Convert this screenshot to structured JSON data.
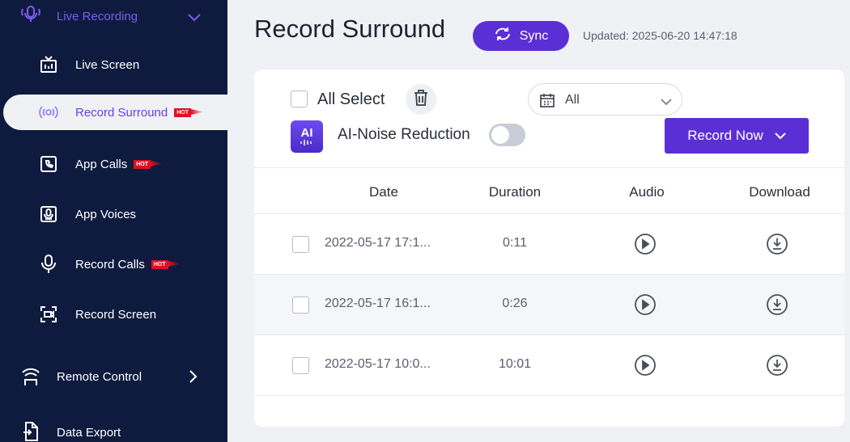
{
  "sidebar": {
    "group_live": "Live Recording",
    "items": [
      {
        "label": "Live Screen",
        "hot": false
      },
      {
        "label": "Record Surround",
        "hot": true
      },
      {
        "label": "App Calls",
        "hot": true
      },
      {
        "label": "App Voices",
        "hot": false
      },
      {
        "label": "Record Calls",
        "hot": true
      },
      {
        "label": "Record Screen",
        "hot": false
      }
    ],
    "group_remote": "Remote Control",
    "group_export": "Data Export",
    "hot_label": "HOT"
  },
  "header": {
    "title": "Record Surround",
    "sync_label": "Sync",
    "updated": "Updated: 2025-06-20 14:47:18"
  },
  "toolbar": {
    "all_select": "All Select",
    "filter_value": "All",
    "ai_badge": "AI",
    "ai_label": "AI-Noise Reduction",
    "record_now": "Record Now"
  },
  "table": {
    "columns": [
      "Date",
      "Duration",
      "Audio",
      "Download"
    ],
    "rows": [
      {
        "date": "2022-05-17 17:1...",
        "duration": "0:11"
      },
      {
        "date": "2022-05-17 16:1...",
        "duration": "0:26"
      },
      {
        "date": "2022-05-17 10:0...",
        "duration": "10:01"
      }
    ]
  },
  "colors": {
    "accent": "#5b2fd6",
    "sidebar": "#0f1b3e",
    "active_text": "#6a3ee0"
  }
}
